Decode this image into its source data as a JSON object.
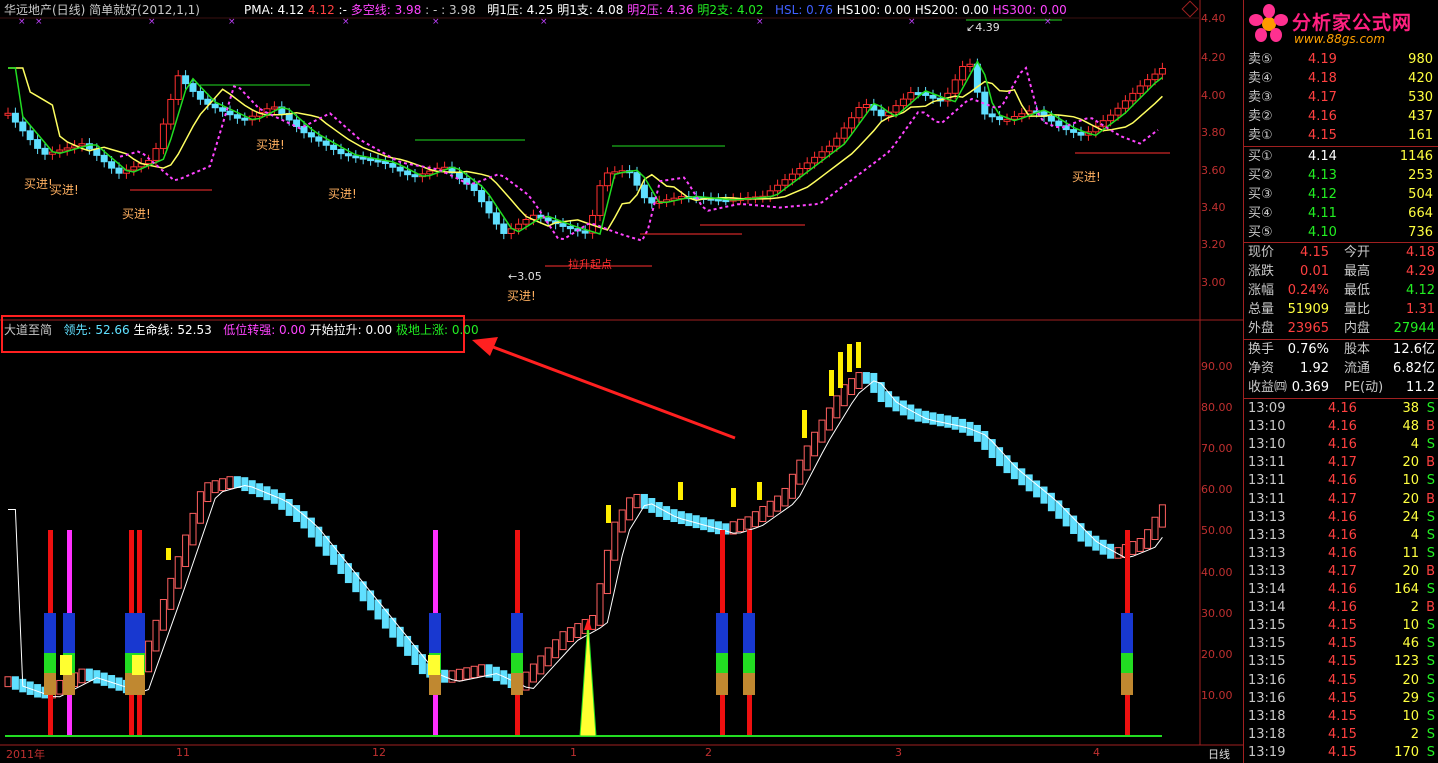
{
  "top_header": {
    "title": "华远地产(日线) 简单就好(2012,1,1)",
    "pma_label": "PMA: 4.12",
    "pma2": "4.12",
    "dash": ":-",
    "duokong_label": "多空线: 3.98",
    "duokong2": ": - : 3.98",
    "ming1ya": "明1压: 4.25",
    "ming1zhi": "明1支: 4.08",
    "ming2ya": "明2压: 4.36",
    "ming2zhi": "明2支: 4.02",
    "hsl": "HSL: 0.76",
    "hs100": "HS100: 0.00",
    "hs200": "HS200: 0.00",
    "hs300": "HS300: 0.00"
  },
  "main_axis": [
    "4.40",
    "4.20",
    "4.00",
    "3.80",
    "3.60",
    "3.40",
    "3.20",
    "3.00"
  ],
  "sub_axis": [
    "90.00",
    "80.00",
    "70.00",
    "60.00",
    "50.00",
    "40.00",
    "30.00",
    "20.00",
    "10.00"
  ],
  "annotations": {
    "buy": "买进!",
    "high_mark": "4.39",
    "low_mark": "3.05",
    "start_point": "拉升起点"
  },
  "sub_header": {
    "name": "大道至简",
    "lingxian": "领先: 52.66",
    "shengmingxian": "生命线: 52.53",
    "diwei": "低位转强: 0.00",
    "kaishi": "开始拉升: 0.00",
    "jidi": "极地上涨: 0.00"
  },
  "date_axis": [
    "2011年",
    "11",
    "12",
    "1",
    "2",
    "3",
    "4"
  ],
  "period_label": "日线",
  "logo": {
    "name": "分析家公式网",
    "url": "www.88gs.com"
  },
  "order_book": {
    "asks": [
      {
        "label": "卖⑤",
        "price": "4.19",
        "vol": "980"
      },
      {
        "label": "卖④",
        "price": "4.18",
        "vol": "420"
      },
      {
        "label": "卖③",
        "price": "4.17",
        "vol": "530"
      },
      {
        "label": "卖②",
        "price": "4.16",
        "vol": "437"
      },
      {
        "label": "卖①",
        "price": "4.15",
        "vol": "161"
      }
    ],
    "bids": [
      {
        "label": "买①",
        "price": "4.14",
        "vol": "1146"
      },
      {
        "label": "买②",
        "price": "4.13",
        "vol": "253"
      },
      {
        "label": "买③",
        "price": "4.12",
        "vol": "504"
      },
      {
        "label": "买④",
        "price": "4.11",
        "vol": "664"
      },
      {
        "label": "买⑤",
        "price": "4.10",
        "vol": "736"
      }
    ]
  },
  "quote": [
    {
      "l1": "现价",
      "v1": "4.15",
      "l2": "今开",
      "v2": "4.18"
    },
    {
      "l1": "涨跌",
      "v1": "0.01",
      "l2": "最高",
      "v2": "4.29"
    },
    {
      "l1": "涨幅",
      "v1": "0.24%",
      "l2": "最低",
      "v2": "4.12"
    },
    {
      "l1": "总量",
      "v1": "51909",
      "l2": "量比",
      "v2": "1.31"
    },
    {
      "l1": "外盘",
      "v1": "23965",
      "l2": "内盘",
      "v2": "27944"
    }
  ],
  "stats": [
    {
      "l1": "换手",
      "v1": "0.76%",
      "l2": "股本",
      "v2": "12.6亿"
    },
    {
      "l1": "净资",
      "v1": "1.92",
      "l2": "流通",
      "v2": "6.82亿"
    },
    {
      "l1": "收益㈣",
      "v1": "0.369",
      "l2": "PE(动)",
      "v2": "11.2"
    }
  ],
  "ticks": [
    {
      "time": "13:09",
      "price": "4.16",
      "vol": "38",
      "side": "S"
    },
    {
      "time": "13:10",
      "price": "4.16",
      "vol": "48",
      "side": "B"
    },
    {
      "time": "13:10",
      "price": "4.16",
      "vol": "4",
      "side": "S"
    },
    {
      "time": "13:11",
      "price": "4.17",
      "vol": "20",
      "side": "B"
    },
    {
      "time": "13:11",
      "price": "4.16",
      "vol": "10",
      "side": "S"
    },
    {
      "time": "13:11",
      "price": "4.17",
      "vol": "20",
      "side": "B"
    },
    {
      "time": "13:13",
      "price": "4.16",
      "vol": "24",
      "side": "S"
    },
    {
      "time": "13:13",
      "price": "4.16",
      "vol": "4",
      "side": "S"
    },
    {
      "time": "13:13",
      "price": "4.16",
      "vol": "11",
      "side": "S"
    },
    {
      "time": "13:13",
      "price": "4.17",
      "vol": "20",
      "side": "B"
    },
    {
      "time": "13:14",
      "price": "4.16",
      "vol": "164",
      "side": "S"
    },
    {
      "time": "13:14",
      "price": "4.16",
      "vol": "2",
      "side": "B"
    },
    {
      "time": "13:15",
      "price": "4.15",
      "vol": "10",
      "side": "S"
    },
    {
      "time": "13:15",
      "price": "4.15",
      "vol": "46",
      "side": "S"
    },
    {
      "time": "13:15",
      "price": "4.15",
      "vol": "123",
      "side": "S"
    },
    {
      "time": "13:16",
      "price": "4.15",
      "vol": "20",
      "side": "S"
    },
    {
      "time": "13:16",
      "price": "4.15",
      "vol": "29",
      "side": "S"
    },
    {
      "time": "13:18",
      "price": "4.15",
      "vol": "10",
      "side": "S"
    },
    {
      "time": "13:18",
      "price": "4.15",
      "vol": "2",
      "side": "S"
    },
    {
      "time": "13:19",
      "price": "4.15",
      "vol": "170",
      "side": "S"
    }
  ],
  "colors": {
    "up": "#ff3030",
    "down": "#60e0ff",
    "yellow_ma": "#ffff60",
    "green_ma": "#22dd22",
    "magenta_ma": "#ff44ff",
    "frame": "#a02020"
  }
}
